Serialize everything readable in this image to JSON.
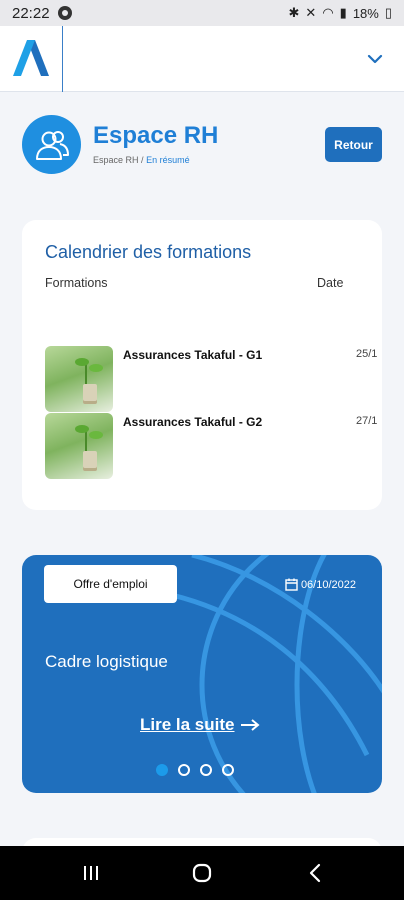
{
  "status": {
    "time": "22:22",
    "battery": "18%"
  },
  "header": {
    "title": "Espace RH",
    "breadcrumb_root": "Espace RH",
    "breadcrumb_sep": "/",
    "breadcrumb_current": "En résumé",
    "back_label": "Retour"
  },
  "calendar": {
    "title": "Calendrier des formations",
    "col_formations": "Formations",
    "col_date": "Date",
    "rows": [
      {
        "title": "Assurances Takaful - G1",
        "date": "25/1"
      },
      {
        "title": "Assurances Takaful - G2",
        "date": "27/1"
      }
    ]
  },
  "promo": {
    "badge": "Offre d'emploi",
    "date": "06/10/2022",
    "title": "Cadre logistique",
    "read_more": "Lire la suite",
    "slides_total": 4,
    "active_slide": 1
  },
  "colors": {
    "primary": "#1f6fbd",
    "accent": "#1f7fd6",
    "dot_active": "#1c9bea"
  }
}
